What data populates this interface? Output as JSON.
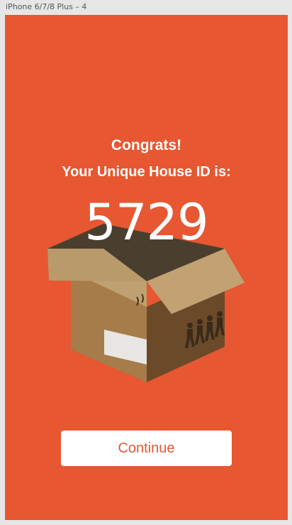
{
  "frame": {
    "label": "iPhone 6/7/8 Plus – 4"
  },
  "screen": {
    "background_color": "#e65732",
    "congrats_text": "Congrats!",
    "subtitle_text": "Your Unique House ID is:",
    "house_id": "5729",
    "illustration": "open-cardboard-box-icon",
    "continue_label": "Continue"
  }
}
